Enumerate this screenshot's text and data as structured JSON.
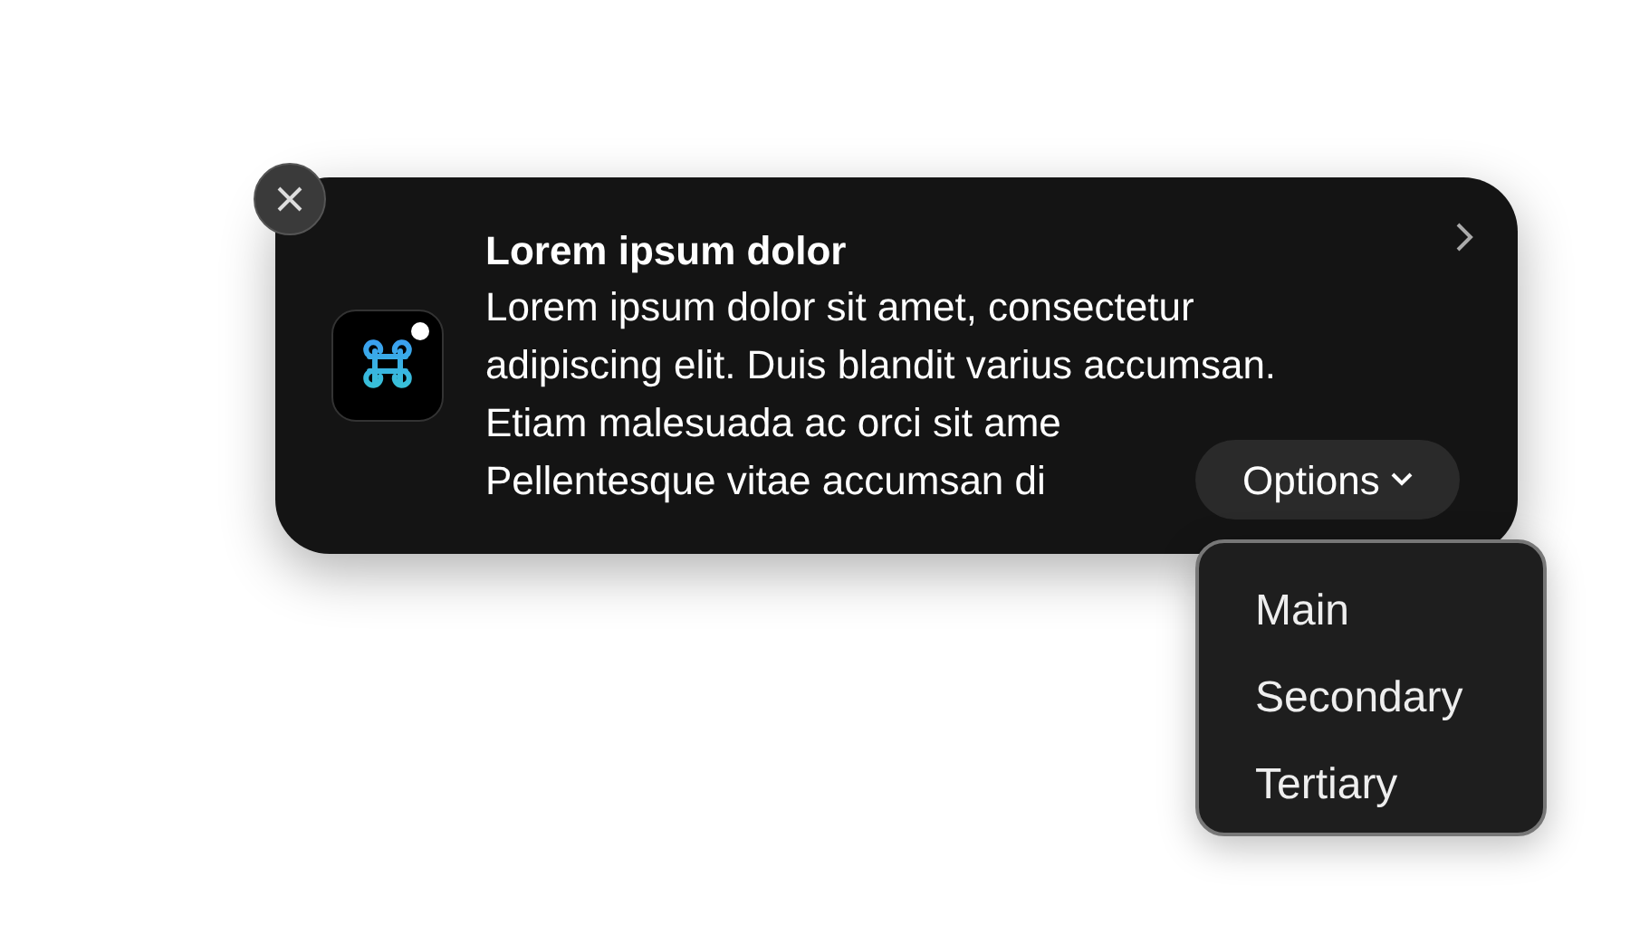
{
  "notification": {
    "title": "Lorem ipsum dolor",
    "body_lines": [
      "Lorem ipsum dolor sit amet, consectetur",
      "adipiscing elit. Duis blandit varius accumsan.",
      "Etiam malesuada ac orci sit ame",
      "Pellentesque vitae accumsan di"
    ],
    "options_button": {
      "label": "Options"
    }
  },
  "options_menu": {
    "items": [
      {
        "label": "Main"
      },
      {
        "label": "Secondary"
      },
      {
        "label": "Tertiary"
      }
    ]
  }
}
